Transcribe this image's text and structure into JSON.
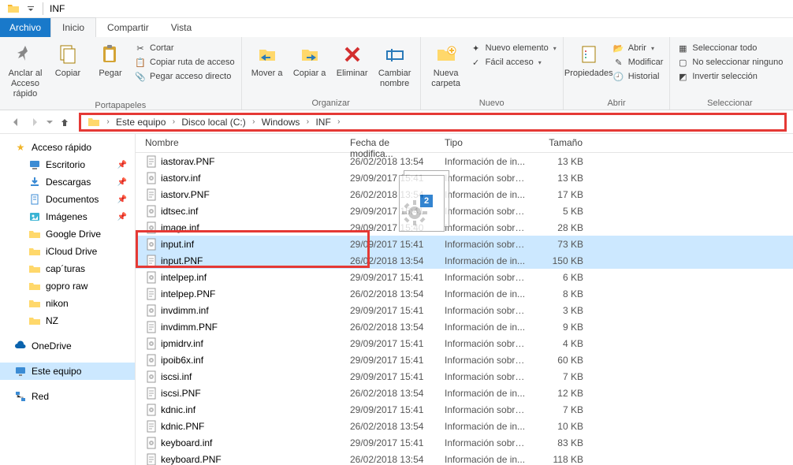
{
  "window": {
    "title": "INF"
  },
  "tabs": {
    "file": "Archivo",
    "home": "Inicio",
    "share": "Compartir",
    "view": "Vista"
  },
  "ribbon": {
    "portapapeles": {
      "label": "Portapapeles",
      "pin": "Anclar al Acceso rápido",
      "copy": "Copiar",
      "paste": "Pegar",
      "cut": "Cortar",
      "copypath": "Copiar ruta de acceso",
      "pasteshortcut": "Pegar acceso directo"
    },
    "organizar": {
      "label": "Organizar",
      "moveto": "Mover a",
      "copyto": "Copiar a",
      "delete": "Eliminar",
      "rename": "Cambiar nombre"
    },
    "nuevo": {
      "label": "Nuevo",
      "newfolder": "Nueva carpeta",
      "newitem": "Nuevo elemento",
      "easyaccess": "Fácil acceso"
    },
    "abrir": {
      "label": "Abrir",
      "properties": "Propiedades",
      "open": "Abrir",
      "modify": "Modificar",
      "history": "Historial"
    },
    "seleccionar": {
      "label": "Seleccionar",
      "selectall": "Seleccionar todo",
      "selectnone": "No seleccionar ninguno",
      "invert": "Invertir selección"
    }
  },
  "breadcrumb": [
    "Este equipo",
    "Disco local (C:)",
    "Windows",
    "INF"
  ],
  "sidebar": {
    "quickaccess": "Acceso rápido",
    "items": [
      {
        "label": "Escritorio",
        "pin": true,
        "icon": "desktop"
      },
      {
        "label": "Descargas",
        "pin": true,
        "icon": "download"
      },
      {
        "label": "Documentos",
        "pin": true,
        "icon": "document"
      },
      {
        "label": "Imágenes",
        "pin": true,
        "icon": "pictures"
      },
      {
        "label": "Google Drive",
        "pin": false,
        "icon": "folder"
      },
      {
        "label": "iCloud Drive",
        "pin": false,
        "icon": "folder"
      },
      {
        "label": "cap´turas",
        "pin": false,
        "icon": "folder"
      },
      {
        "label": "gopro raw",
        "pin": false,
        "icon": "folder"
      },
      {
        "label": "nikon",
        "pin": false,
        "icon": "folder"
      },
      {
        "label": "NZ",
        "pin": false,
        "icon": "folder"
      }
    ],
    "onedrive": "OneDrive",
    "thispc": "Este equipo",
    "network": "Red"
  },
  "columns": {
    "name": "Nombre",
    "date": "Fecha de modifica...",
    "type": "Tipo",
    "size": "Tamaño"
  },
  "files": [
    {
      "name": "iastorav.PNF",
      "date": "26/02/2018 13:54",
      "type": "Información de in...",
      "size": "13 KB",
      "icon": "pnf"
    },
    {
      "name": "iastorv.inf",
      "date": "29/09/2017 15:41",
      "type": "Información sobre...",
      "size": "13 KB",
      "icon": "inf"
    },
    {
      "name": "iastorv.PNF",
      "date": "26/02/2018 13:54",
      "type": "Información de in...",
      "size": "17 KB",
      "icon": "pnf"
    },
    {
      "name": "idtsec.inf",
      "date": "29/09/2017 15:41",
      "type": "Información sobre...",
      "size": "5 KB",
      "icon": "inf"
    },
    {
      "name": "image.inf",
      "date": "29/09/2017 15:40",
      "type": "Información sobre...",
      "size": "28 KB",
      "icon": "inf"
    },
    {
      "name": "input.inf",
      "date": "29/09/2017 15:41",
      "type": "Información sobre...",
      "size": "73 KB",
      "icon": "inf",
      "sel": true
    },
    {
      "name": "input.PNF",
      "date": "26/02/2018 13:54",
      "type": "Información de in...",
      "size": "150 KB",
      "icon": "pnf",
      "sel": true
    },
    {
      "name": "intelpep.inf",
      "date": "29/09/2017 15:41",
      "type": "Información sobre...",
      "size": "6 KB",
      "icon": "inf"
    },
    {
      "name": "intelpep.PNF",
      "date": "26/02/2018 13:54",
      "type": "Información de in...",
      "size": "8 KB",
      "icon": "pnf"
    },
    {
      "name": "invdimm.inf",
      "date": "29/09/2017 15:41",
      "type": "Información sobre...",
      "size": "3 KB",
      "icon": "inf"
    },
    {
      "name": "invdimm.PNF",
      "date": "26/02/2018 13:54",
      "type": "Información de in...",
      "size": "9 KB",
      "icon": "pnf"
    },
    {
      "name": "ipmidrv.inf",
      "date": "29/09/2017 15:41",
      "type": "Información sobre...",
      "size": "4 KB",
      "icon": "inf"
    },
    {
      "name": "ipoib6x.inf",
      "date": "29/09/2017 15:41",
      "type": "Información sobre...",
      "size": "60 KB",
      "icon": "inf"
    },
    {
      "name": "iscsi.inf",
      "date": "29/09/2017 15:41",
      "type": "Información sobre...",
      "size": "7 KB",
      "icon": "inf"
    },
    {
      "name": "iscsi.PNF",
      "date": "26/02/2018 13:54",
      "type": "Información de in...",
      "size": "12 KB",
      "icon": "pnf"
    },
    {
      "name": "kdnic.inf",
      "date": "29/09/2017 15:41",
      "type": "Información sobre...",
      "size": "7 KB",
      "icon": "inf"
    },
    {
      "name": "kdnic.PNF",
      "date": "26/02/2018 13:54",
      "type": "Información de in...",
      "size": "10 KB",
      "icon": "pnf"
    },
    {
      "name": "keyboard.inf",
      "date": "29/09/2017 15:41",
      "type": "Información sobre...",
      "size": "83 KB",
      "icon": "inf"
    },
    {
      "name": "keyboard.PNF",
      "date": "26/02/2018 13:54",
      "type": "Información de in...",
      "size": "118 KB",
      "icon": "pnf"
    }
  ],
  "drag_badge": "2"
}
